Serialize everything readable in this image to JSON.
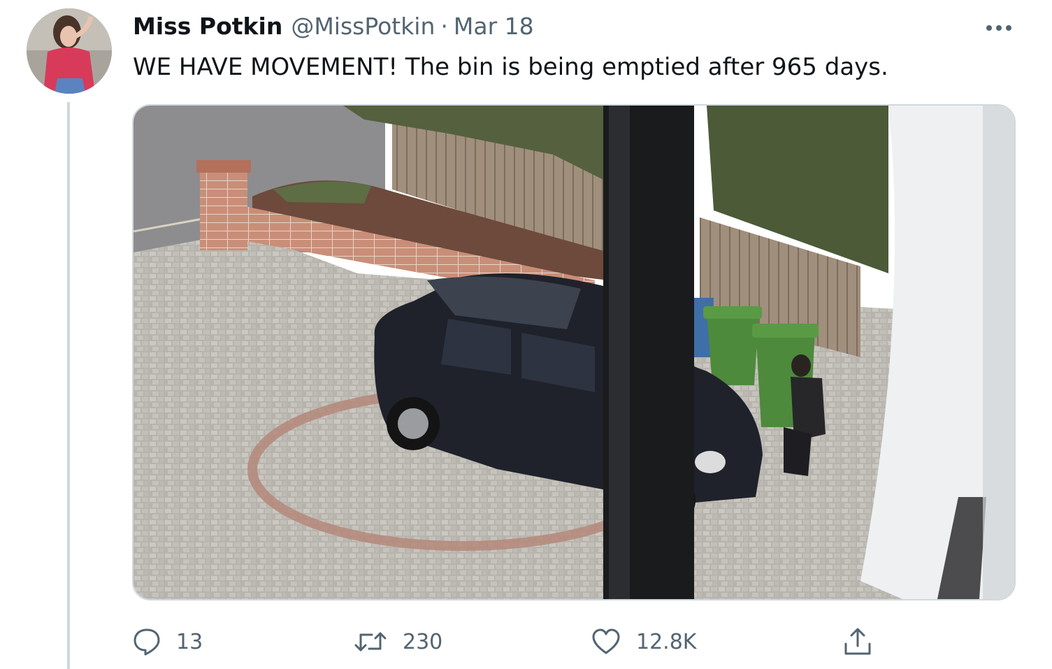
{
  "tweet": {
    "author": {
      "name": "Miss Potkin",
      "handle": "@MissPotkin",
      "avatar_icon": "profile-photo"
    },
    "separator": "·",
    "date": "Mar 18",
    "text": "WE HAVE MOVEMENT! The bin is being emptied after 965 days.",
    "media": {
      "description_icon": "photo-of-car-and-green-bins-through-window"
    },
    "actions": {
      "reply_icon": "speech-bubble-icon",
      "replies": "13",
      "retweet_icon": "retweet-arrows-icon",
      "retweets": "230",
      "like_icon": "heart-icon",
      "likes": "12.8K",
      "share_icon": "share-upload-icon"
    },
    "more_icon": "ellipsis-icon"
  },
  "colors": {
    "text_primary": "#0f1419",
    "text_secondary": "#536471",
    "border": "#cfd9de"
  }
}
